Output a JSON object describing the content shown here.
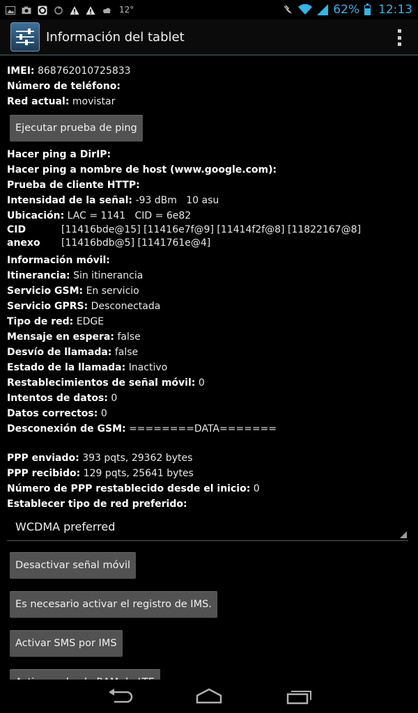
{
  "status_bar": {
    "temperature": "12°",
    "battery_percent": "62%",
    "battery_level": 0.62,
    "time": "12:13",
    "accent_color": "#33b5e5"
  },
  "action_bar": {
    "title": "Información del tablet",
    "app_icon": "settings-sliders-icon",
    "overflow_icon": "overflow-menu-icon"
  },
  "info": {
    "imei": {
      "label": "IMEI:",
      "value": "868762010725833"
    },
    "phone": {
      "label": "Número de teléfono:",
      "value": ""
    },
    "network": {
      "label": "Red actual:",
      "value": "movistar"
    },
    "ping_button": "Ejecutar prueba de ping",
    "ping_ip": {
      "label": "Hacer ping a DirIP:",
      "value": ""
    },
    "ping_host": {
      "label": "Hacer ping a nombre de host (www.google.com):",
      "value": ""
    },
    "http_test": {
      "label": "Prueba de cliente HTTP:",
      "value": ""
    },
    "signal": {
      "label": "Intensidad de la señal:",
      "value": "-93 dBm   10 asu"
    },
    "location": {
      "label": "Ubicación:",
      "value": "LAC = 1141   CID = 6e82"
    },
    "cid_label": "CID anexo",
    "cid_line1": "[11416bde@15] [11416e7f@9] [11414f2f@8] [11822167@8]",
    "cid_line2": "[11416bdb@5] [1141761e@4]",
    "mobile_info": {
      "label": "Información móvil:",
      "value": ""
    },
    "roaming": {
      "label": "Itinerancia:",
      "value": "Sin itinerancia"
    },
    "gsm_service": {
      "label": "Servicio GSM:",
      "value": "En servicio"
    },
    "gprs_service": {
      "label": "Servicio GPRS:",
      "value": "Desconectada"
    },
    "network_type": {
      "label": "Tipo de red:",
      "value": "EDGE"
    },
    "message_waiting": {
      "label": "Mensaje en espera:",
      "value": "false"
    },
    "call_forward": {
      "label": "Desvío de llamada:",
      "value": "false"
    },
    "call_state": {
      "label": "Estado de la llamada:",
      "value": "Inactivo"
    },
    "signal_resets": {
      "label": "Restablecimientos de señal móvil:",
      "value": "0"
    },
    "data_attempts": {
      "label": "Intentos de datos:",
      "value": "0"
    },
    "data_success": {
      "label": "Datos correctos:",
      "value": "0"
    },
    "gsm_disconnect": {
      "label": "Desconexión de GSM:",
      "value": "========DATA======="
    },
    "ppp_sent": {
      "label": "PPP enviado:",
      "value": "393 pqts, 29362 bytes"
    },
    "ppp_received": {
      "label": "PPP recibido:",
      "value": "129 pqts, 25641 bytes"
    },
    "ppp_resets": {
      "label": "Número de PPP restablecido desde el inicio:",
      "value": "0"
    },
    "preferred_network": {
      "label": "Establecer tipo de red preferido:",
      "value": ""
    },
    "network_spinner_value": "WCDMA preferred",
    "btn_disable_radio": "Desactivar señal móvil",
    "btn_ims_registration": "Es necesario activar el registro de IMS.",
    "btn_sms_ims": "Activar SMS por IMS",
    "btn_ram_dump": "Activar volcado RAM de LTE"
  },
  "nav_bar": {
    "back_icon": "back-icon",
    "home_icon": "home-icon",
    "recents_icon": "recent-apps-icon"
  }
}
